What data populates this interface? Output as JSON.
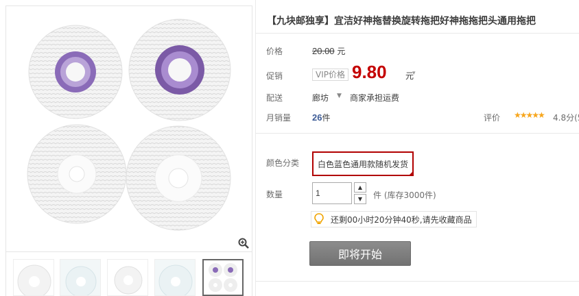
{
  "product": {
    "title": "【九块邮独享】宜洁好神拖替换旋转拖把好神拖拖把头通用拖把"
  },
  "price": {
    "label": "价格",
    "original": "20.00",
    "currency_unit": "元"
  },
  "promo": {
    "label": "促销",
    "vip_tag": "VIP价格",
    "price": "9.80",
    "unit": "元",
    "caret": "▾",
    "color": "#c40000"
  },
  "shipping": {
    "label": "配送",
    "from": "廊坊",
    "caret": "▼",
    "note": "商家承担运费"
  },
  "sales": {
    "label": "月销量",
    "count": "26",
    "unit": "件"
  },
  "rating": {
    "label": "评价",
    "stars": "★★★★★",
    "value": "4.8分(5",
    "star_color": "#f7a61d"
  },
  "color_category": {
    "label": "颜色分类",
    "selected": "白色蓝色通用款随机发货",
    "selected_border": "#b10000"
  },
  "quantity": {
    "label": "数量",
    "value": "1",
    "stock": "件 (库存3000件)"
  },
  "countdown_tip": {
    "icon": "lightbulb-icon",
    "text": "还剩00小时20分钟40秒,请先收藏商品"
  },
  "buy_button": {
    "label": "即将开始"
  },
  "gallery": {
    "zoom_icon": "magnifier-icon",
    "thumbnails": [
      "thumb-1",
      "thumb-2",
      "thumb-3",
      "thumb-4",
      "thumb-5"
    ],
    "selected_index": 4
  }
}
